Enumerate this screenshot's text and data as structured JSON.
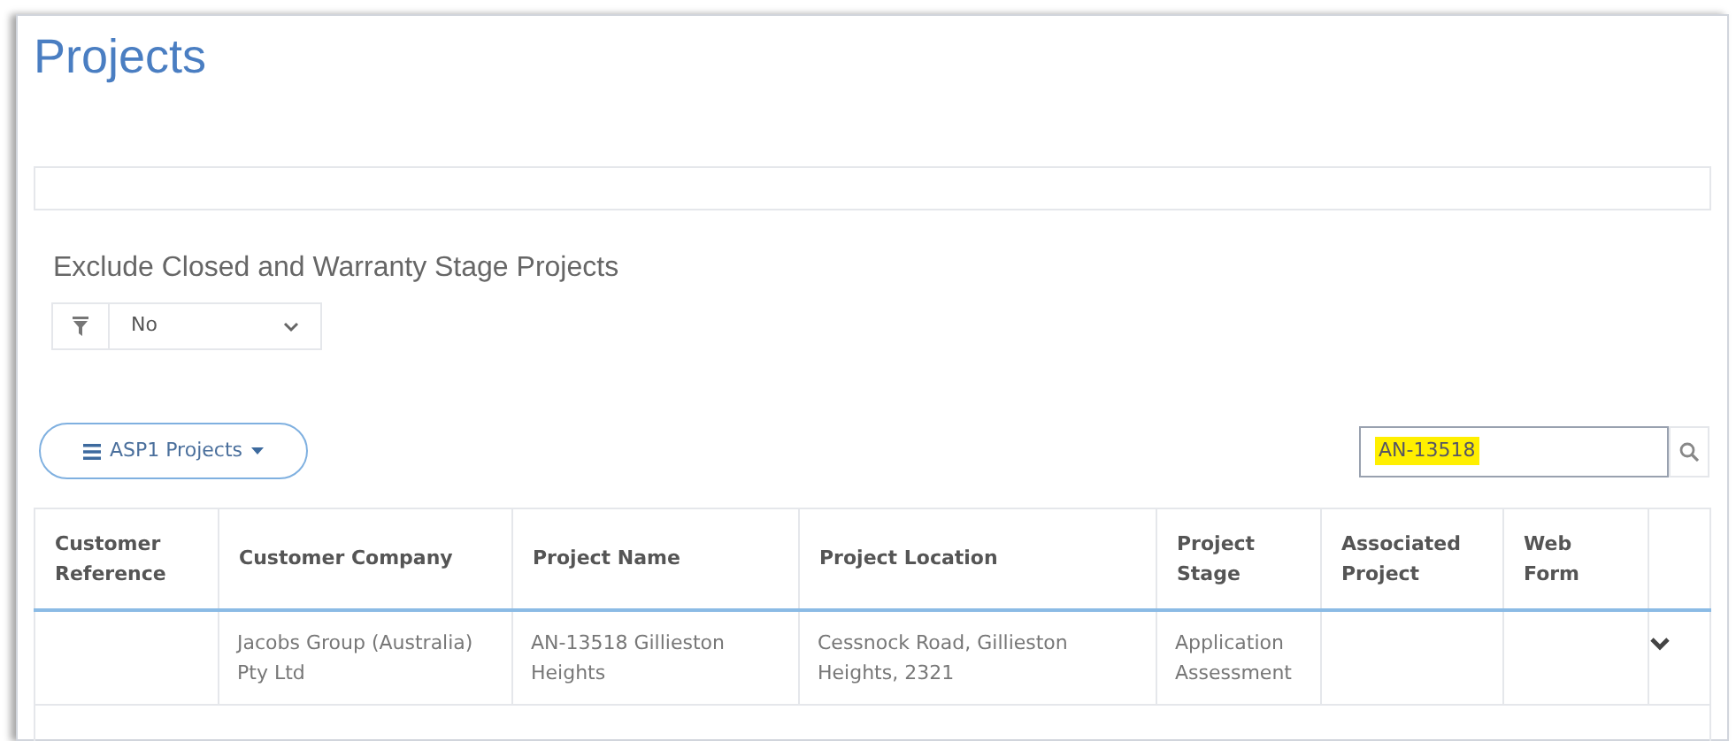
{
  "page": {
    "title": "Projects"
  },
  "filter": {
    "label": "Exclude Closed and Warranty Stage Projects",
    "value": "No"
  },
  "view_button": {
    "label": "ASP1 Projects"
  },
  "search": {
    "value": "AN-13518",
    "highlighted": true
  },
  "table": {
    "columns": [
      "Customer Reference",
      "Customer Company",
      "Project Name",
      "Project Location",
      "Project Stage",
      "Associated Project",
      "Web Form",
      ""
    ],
    "rows": [
      {
        "cells": [
          "",
          "Jacobs Group (Australia) Pty Ltd",
          "AN-13518 Gillieston Heights",
          "Cessnock Road, Gillieston Heights, 2321",
          "Application Assessment",
          "",
          ""
        ],
        "expanded": false
      }
    ]
  }
}
